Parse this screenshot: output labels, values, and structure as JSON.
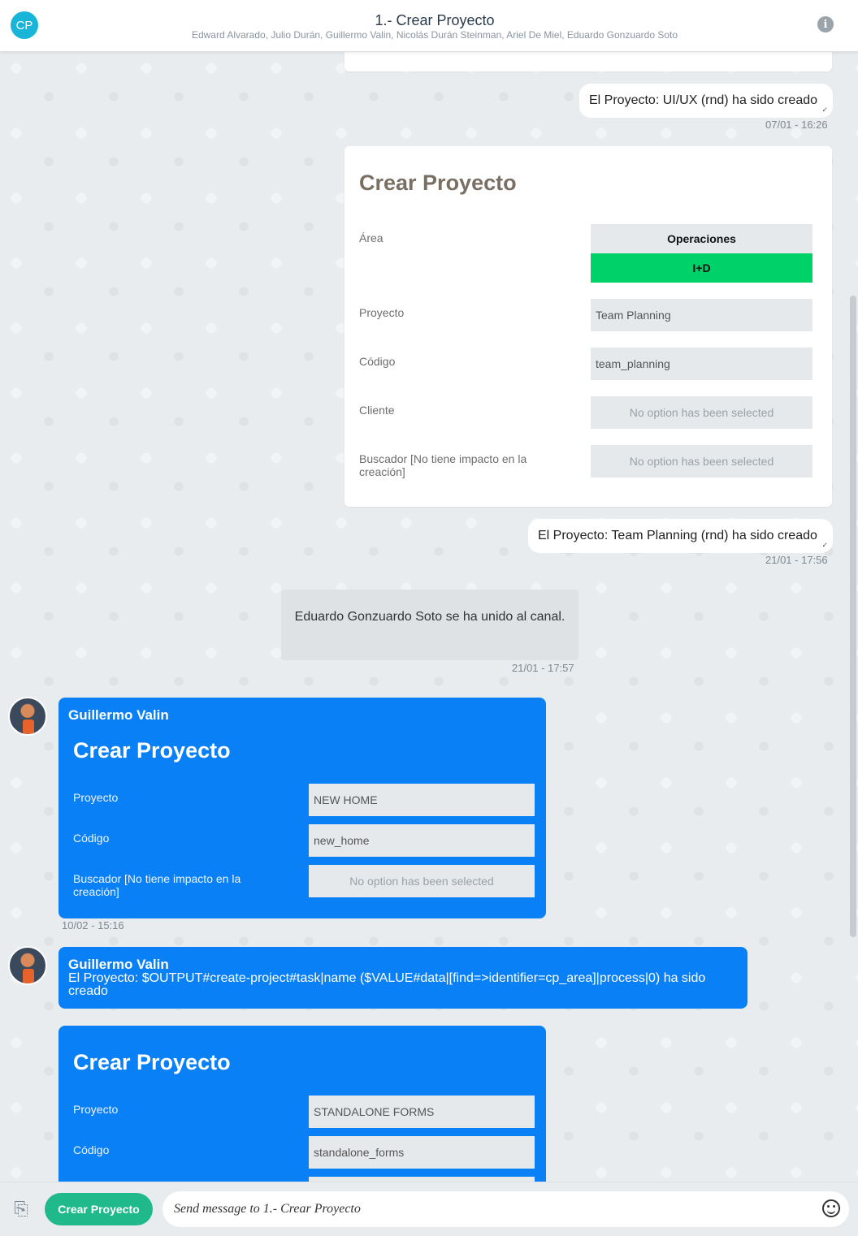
{
  "header": {
    "avatar_initials": "CP",
    "title": "1.- Crear Proyecto",
    "members": "Edward Alvarado, Julio Durán, Guillermo Valin, Nicolás Durán Steinman, Ariel De Miel, Eduardo Gonzuardo Soto",
    "info_icon": "i"
  },
  "messages": {
    "sys1": {
      "text": "El Proyecto:  UI/UX (rnd)  ha sido creado",
      "time": "07/01 - 16:26"
    },
    "form1": {
      "title": "Crear Proyecto",
      "area_label": "Área",
      "area_options": [
        "Operaciones",
        "I+D"
      ],
      "proyecto_label": "Proyecto",
      "proyecto_value": "Team Planning",
      "codigo_label": "Código",
      "codigo_value": "team_planning",
      "cliente_label": "Cliente",
      "cliente_value": "No option has been selected",
      "buscador_label": "Buscador [No tiene impacto en la creación]",
      "buscador_value": "No option has been selected"
    },
    "sys2": {
      "text": "El Proyecto:  Team Planning (rnd)  ha sido creado",
      "time": "21/01 - 17:56"
    },
    "join": {
      "text": "Eduardo Gonzuardo Soto se ha unido al canal.",
      "time": "21/01 - 17:57"
    },
    "form2": {
      "author": "Guillermo Valin",
      "title": "Crear Proyecto",
      "proyecto_label": "Proyecto",
      "proyecto_value": "NEW HOME",
      "codigo_label": "Código",
      "codigo_value": "new_home",
      "buscador_label": "Buscador [No tiene impacto en la creación]",
      "buscador_value": "No option has been selected",
      "time": "10/02 - 15:16"
    },
    "msg3": {
      "author": "Guillermo Valin",
      "text": "El Proyecto: $OUTPUT#create-project#task|name ($VALUE#data|[find=>identifier=cp_area]|process|0)  ha sido creado"
    },
    "form3": {
      "title": "Crear Proyecto",
      "proyecto_label": "Proyecto",
      "proyecto_value": "STANDALONE FORMS",
      "codigo_label": "Código",
      "codigo_value": "standalone_forms"
    }
  },
  "footer": {
    "button_label": "Crear Proyecto",
    "input_placeholder": "Send message to 1.- Crear Proyecto"
  },
  "colors": {
    "accent_blue": "#0a80f7",
    "green_button": "#1fb98b",
    "selected_option": "#00d26a"
  }
}
